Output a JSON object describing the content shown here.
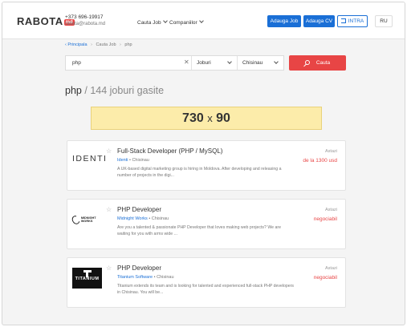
{
  "header": {
    "logo_text": "RABOTA",
    "logo_badge": "md",
    "phone": "+373 696-19917",
    "email": "rabota@rabota.md",
    "nav": [
      {
        "label": "Cauta Job"
      },
      {
        "label": "Companiilor"
      }
    ],
    "add_job_label": "Adauga Job",
    "add_cv_label": "Adauga CV",
    "login_label": "INTRA",
    "language": "RU"
  },
  "breadcrumb": [
    "Principala",
    "Cauta Job",
    "php"
  ],
  "search": {
    "query": "php",
    "category": "Joburi",
    "city": "Chisinau",
    "button_label": "Cauta"
  },
  "results": {
    "query": "php",
    "separator": "/",
    "count_text": "144 joburi gasite"
  },
  "ad": {
    "width": "730",
    "times": "x",
    "height": "90"
  },
  "jobs": [
    {
      "title": "Full-Stack Developer (PHP / MySQL)",
      "company": "Identi",
      "city": "Chisinau",
      "description": "A UK-based digital marketing group is hiring in Moldova. After developing and releasing a number of projects in the digi...",
      "date": "Astazi",
      "salary": "de la 1300 usd",
      "logo_text": "IDENTI"
    },
    {
      "title": "PHP Developer",
      "company": "Midnight Works",
      "city": "Chisinau",
      "description": "Are you a talented & passionate PHP Developer that loves making web projects? We are waiting for you with arms wide ...",
      "date": "Astazi",
      "salary": "negociabil",
      "logo_text": "MIDNIGHT WORKS"
    },
    {
      "title": "PHP Developer",
      "company": "Titanium Software",
      "city": "Chisinau",
      "description": "Titanium extends its team and is looking for talented and experienced full-stack PHP developers in Chisinau. You will be...",
      "date": "Astazi",
      "salary": "negociabil",
      "logo_text": "TITANIUM"
    }
  ],
  "colors": {
    "primary": "#1a6fd6",
    "accent": "#e84545",
    "banner": "#fcecaa"
  }
}
